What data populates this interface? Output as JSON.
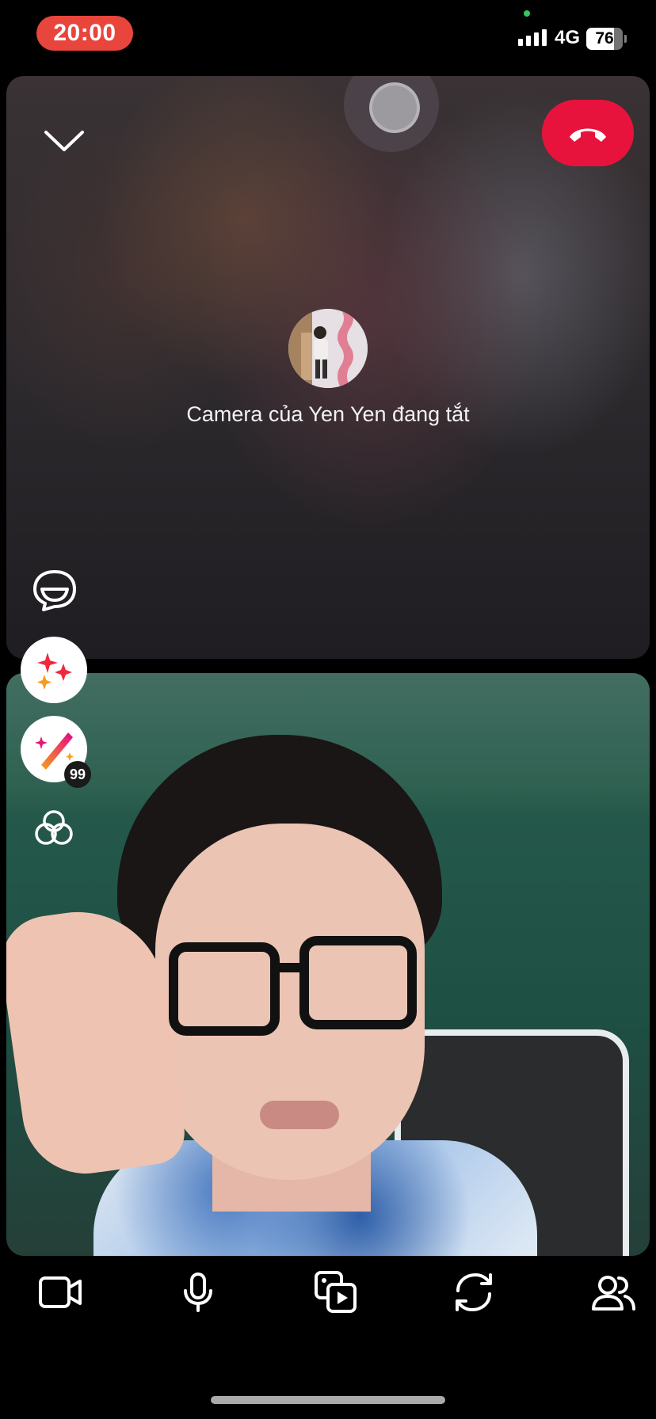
{
  "status_bar": {
    "time": "20:00",
    "network": "4G",
    "battery": "76",
    "battery_level": 0.76
  },
  "remote": {
    "camera_off_message": "Camera của Yen Yen đang tắt"
  },
  "side_tools": {
    "magic_badge": "99"
  },
  "colors": {
    "end_call": "#e8133c",
    "time_pill": "#e8453c",
    "effects_red": "#f0283c",
    "effects_orange": "#f79b1c"
  },
  "icons": {
    "collapse": "chevron-down-icon",
    "end_call": "phone-hangup-icon",
    "captions": "captions-bubble-icon",
    "effects": "sparkles-icon",
    "magic": "magic-wand-icon",
    "filters": "filters-circles-icon",
    "toolbar": [
      "video-camera-icon",
      "microphone-icon",
      "share-media-icon",
      "flip-camera-icon",
      "participants-icon"
    ]
  }
}
